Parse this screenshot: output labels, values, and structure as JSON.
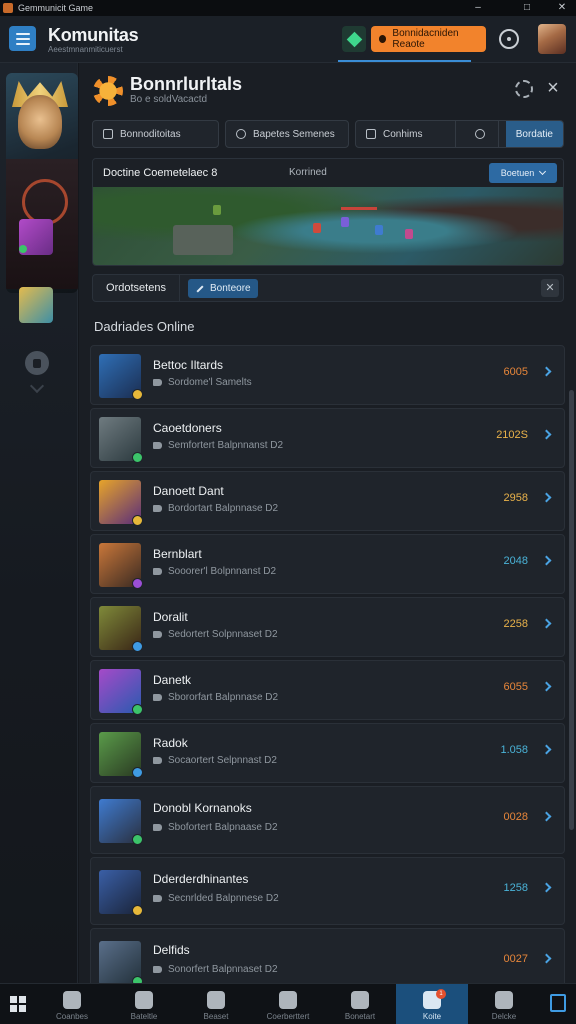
{
  "window": {
    "title": "Gemmunicit Game",
    "minimize": "–",
    "maximize": "□",
    "close": "✕"
  },
  "header": {
    "app_name": "Komunitas",
    "app_subtitle": "Aeestmnanmiticuerst",
    "cta_label": "Bonnidacniden Reaote",
    "icons": {
      "menu": "hamburger-icon",
      "gem": "gem-icon",
      "clock": "clock-icon",
      "avatar": "user-avatar"
    }
  },
  "panel": {
    "title": "Bonnrlurltals",
    "subtitle": "Bo e soldVacactd",
    "tabs": [
      {
        "label": "Bonnoditoitas",
        "icon": "grid-icon"
      },
      {
        "label": "Bapetes Semenes",
        "icon": "compass-icon"
      },
      {
        "label": "Conhims",
        "icon": "hammer-icon"
      },
      {
        "label": "Bordatie",
        "icon": ""
      }
    ]
  },
  "match": {
    "title": "Doctine Coemetelaec 8",
    "meta": "Korrined",
    "button": "Boetuen"
  },
  "filter": {
    "label": "Ordotsetens",
    "button": "Bonteore",
    "clear": "✕"
  },
  "section_title": "Dadriades Online",
  "players": [
    {
      "name": "Bettoc Iltards",
      "info": "Sordome'l Samelts",
      "score": "6005",
      "score_color": "#e7863a",
      "thumb": [
        "#2f6fb6",
        "#1b2e52"
      ],
      "role_color": "#e6b83a"
    },
    {
      "name": "Caoetdoners",
      "info": "Semfortert Balpnnanst D2",
      "score": "2102S",
      "score_color": "#e9b24a",
      "thumb": [
        "#6f7b80",
        "#2c3a3f"
      ],
      "role_color": "#3cc46a"
    },
    {
      "name": "Danoett Dant",
      "info": "Bordortart Balpnnase D2",
      "score": "2958",
      "score_color": "#e9b24a",
      "thumb": [
        "#e7a42a",
        "#5a2d7a"
      ],
      "role_color": "#e6b83a"
    },
    {
      "name": "Bernblart",
      "info": "Sooorer'l Bolpnnanst D2",
      "score": "2048",
      "score_color": "#4ab3d8",
      "thumb": [
        "#c9773a",
        "#3a2a22"
      ],
      "role_color": "#9b4fd6"
    },
    {
      "name": "Doralit",
      "info": "Sedortert Solpnnaset D2",
      "score": "2258",
      "score_color": "#e9b24a",
      "thumb": [
        "#7f8a3a",
        "#3a2616"
      ],
      "role_color": "#3f9be3"
    },
    {
      "name": "Danetk",
      "info": "Sbororfart Balpnnase D2",
      "score": "6055",
      "score_color": "#e7863a",
      "thumb": [
        "#a54ac8",
        "#2a5ab0"
      ],
      "role_color": "#3cc46a"
    },
    {
      "name": "Radok",
      "info": "Socaortert Selpnnast D2",
      "score": "1.058",
      "score_color": "#4ab3d8",
      "thumb": [
        "#5a9b4a",
        "#2a3a22"
      ],
      "role_color": "#3f9be3"
    },
    {
      "name": "Donobl Kornanoks",
      "info": "Sbofortert Balpnaase D2",
      "score": "0028",
      "score_color": "#e7863a",
      "thumb": [
        "#3f7bd0",
        "#2a3040"
      ],
      "role_color": "#3cc46a",
      "tall": true
    },
    {
      "name": "Dderderdhinantes",
      "info": "Secnrlded Balpnnese D2",
      "score": "1258",
      "score_color": "#4ab3d8",
      "thumb": [
        "#3a5fa6",
        "#1a243a"
      ],
      "role_color": "#e6b83a",
      "tall": true
    },
    {
      "name": "Delfids",
      "info": "Sonorfert Balpnnaset D2",
      "score": "0027",
      "score_color": "#e7863a",
      "thumb": [
        "#5a6f8a",
        "#22303a"
      ],
      "role_color": "#3cc46a",
      "tall": true
    }
  ],
  "taskbar": [
    {
      "label": "Coanbes",
      "icon": "swirl-icon"
    },
    {
      "label": "Bateltle",
      "icon": "flag-icon"
    },
    {
      "label": "Beaset",
      "icon": "heart-icon"
    },
    {
      "label": "Coerberttert",
      "icon": "compass-icon"
    },
    {
      "label": "Bonetart",
      "icon": "gear-icon"
    },
    {
      "label": "Koite",
      "icon": "chest-icon",
      "active": true,
      "badge": "1"
    },
    {
      "label": "Delcke",
      "icon": "box-icon"
    }
  ]
}
